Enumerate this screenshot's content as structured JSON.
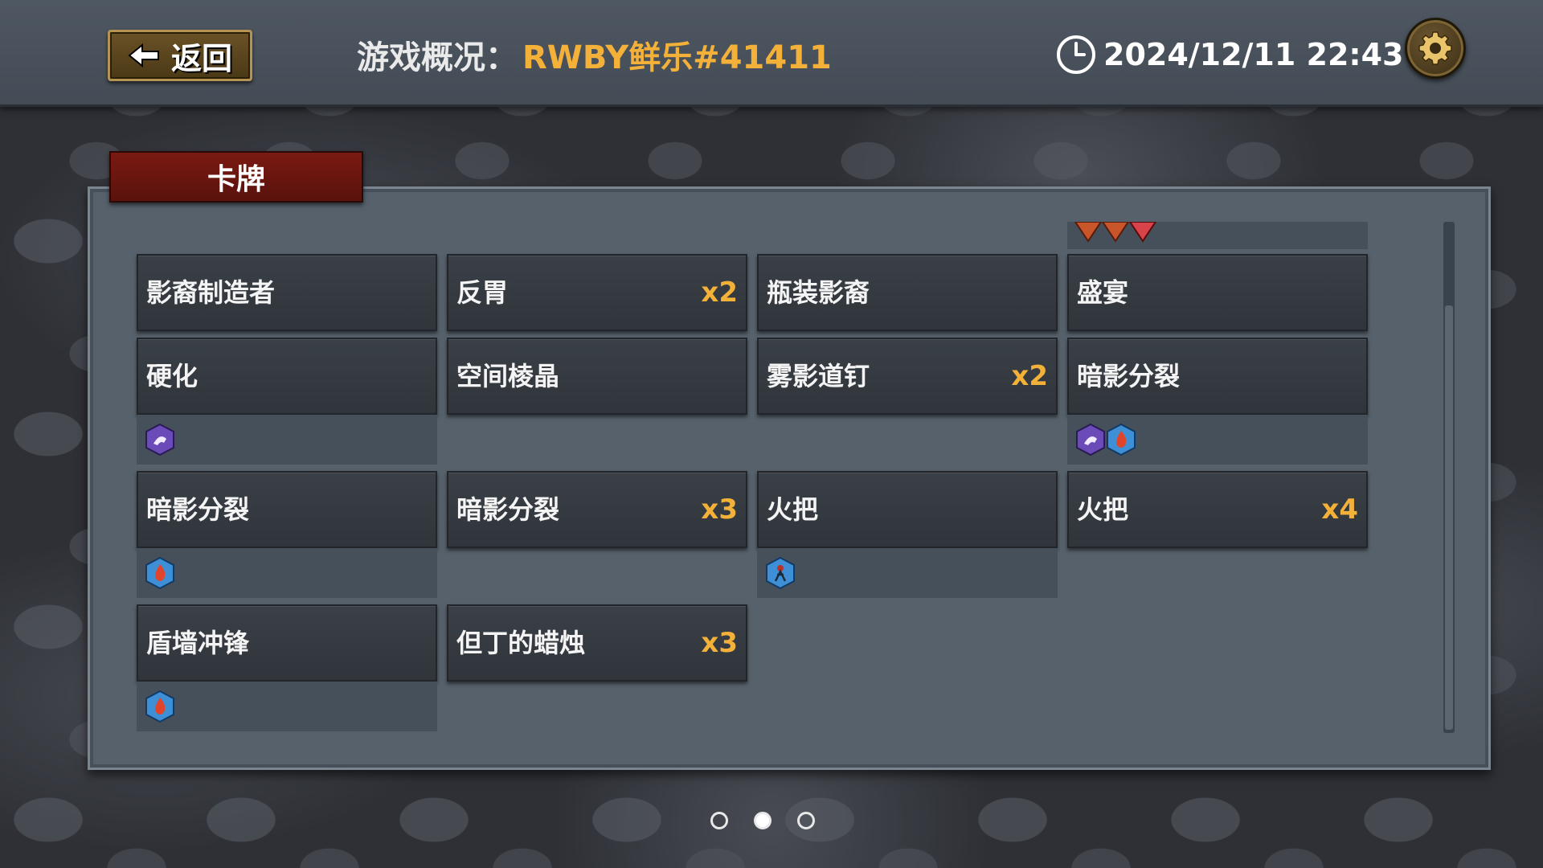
{
  "header": {
    "back_label": "返回",
    "title_prefix": "游戏概况：",
    "game_name": "RWBY鲜乐#41411",
    "datetime": "2024/12/11 22:43"
  },
  "tab": {
    "label": "卡牌"
  },
  "cards": [
    {
      "name": "影裔制造者",
      "count": ""
    },
    {
      "name": "反胃",
      "count": "x2"
    },
    {
      "name": "瓶装影裔",
      "count": ""
    },
    {
      "name": "盛宴",
      "count": ""
    },
    {
      "name": "硬化",
      "count": ""
    },
    {
      "name": "空间棱晶",
      "count": ""
    },
    {
      "name": "雾影道钉",
      "count": "x2"
    },
    {
      "name": "暗影分裂",
      "count": ""
    },
    {
      "name": "暗影分裂",
      "count": ""
    },
    {
      "name": "暗影分裂",
      "count": "x3"
    },
    {
      "name": "火把",
      "count": ""
    },
    {
      "name": "火把",
      "count": "x4"
    },
    {
      "name": "盾墙冲锋",
      "count": ""
    },
    {
      "name": "但丁的蜡烛",
      "count": "x3"
    }
  ],
  "pagination": {
    "pages": 3,
    "current": 2
  },
  "colors": {
    "accent_gold": "#f3b13a",
    "tab_red": "#7a1a12",
    "card_bg": "#353a40",
    "panel_bg": "#57616b"
  },
  "icons": {
    "back": "left-arrow-icon",
    "clock": "clock-icon",
    "settings": "gear-icon",
    "tags": [
      "purple-ghost-hex-icon",
      "fire-hex-icon",
      "figure-hex-icon",
      "red-shard-icon"
    ]
  }
}
